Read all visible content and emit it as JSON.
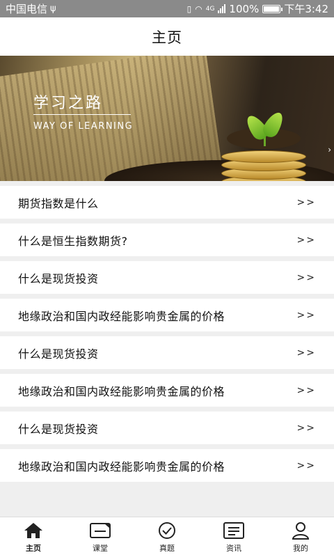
{
  "status_bar": {
    "carrier": "中国电信",
    "network": "4G",
    "battery": "100%",
    "time": "下午3:42"
  },
  "header": {
    "title": "主页"
  },
  "banner": {
    "title": "学习之路",
    "subtitle": "WAY OF LEARNING",
    "nav_arrow": "›"
  },
  "list": {
    "items": [
      {
        "title": "期货指数是什么",
        "arrow": ">>"
      },
      {
        "title": "什么是恒生指数期货?",
        "arrow": ">>"
      },
      {
        "title": "什么是现货投资",
        "arrow": ">>"
      },
      {
        "title": "地缘政治和国内政经能影响贵金属的价格",
        "arrow": ">>"
      },
      {
        "title": "什么是现货投资",
        "arrow": ">>"
      },
      {
        "title": "地缘政治和国内政经能影响贵金属的价格",
        "arrow": ">>"
      },
      {
        "title": "什么是现货投资",
        "arrow": ">>"
      },
      {
        "title": "地缘政治和国内政经能影响贵金属的价格",
        "arrow": ">>"
      }
    ]
  },
  "tabs": [
    {
      "label": "主页",
      "icon": "home-icon",
      "active": true
    },
    {
      "label": "课堂",
      "icon": "classroom-icon",
      "active": false
    },
    {
      "label": "真题",
      "icon": "check-circle-icon",
      "active": false
    },
    {
      "label": "资讯",
      "icon": "news-icon",
      "active": false
    },
    {
      "label": "我的",
      "icon": "user-icon",
      "active": false
    }
  ]
}
